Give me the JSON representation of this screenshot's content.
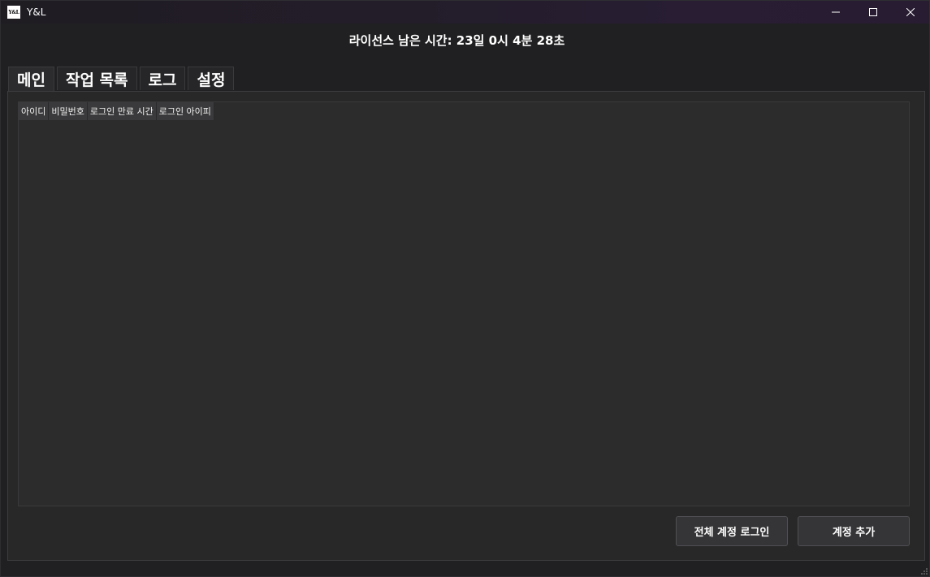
{
  "window": {
    "title": "Y&L",
    "icon_label": "Y&L",
    "controls": [
      "minimize-icon",
      "maximize-icon",
      "close-icon"
    ]
  },
  "license": {
    "text": "라이선스 남은 시간: 23일 0시 4분 28초"
  },
  "tabs": [
    {
      "label": "메인",
      "active": true
    },
    {
      "label": "작업 목록",
      "active": false
    },
    {
      "label": "로그",
      "active": false
    },
    {
      "label": "설정",
      "active": false
    }
  ],
  "table": {
    "columns": [
      "아이디",
      "비밀번호",
      "로그인 만료 시간",
      "로그인 아이피"
    ],
    "rows": []
  },
  "buttons": {
    "login_all": "전체 계정 로그인",
    "add_account": "계정 추가"
  },
  "colors": {
    "background": "#202022",
    "panel": "#282828",
    "header_cell": "#3a3a3c",
    "text": "#ffffff"
  }
}
